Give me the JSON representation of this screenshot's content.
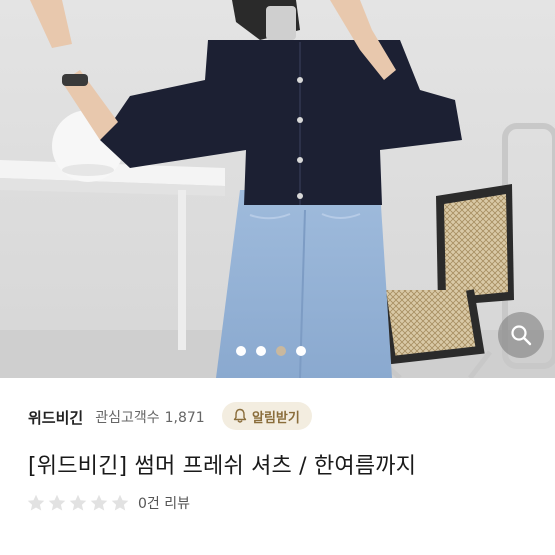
{
  "seller": {
    "name": "위드비긴",
    "followers_label": "관심고객수",
    "followers_count": "1,871",
    "alert_button_label": "알림받기"
  },
  "product": {
    "title": "[위드비긴] 썸머 프레쉬 셔츠 / 한여름까지",
    "rating": 0,
    "max_rating": 5,
    "review_label": "0건 리뷰"
  },
  "gallery": {
    "image_count": 4,
    "active_index": 2
  },
  "icons": {
    "zoom": "search-icon",
    "alert": "bell-icon",
    "rating": "star-icon"
  },
  "colors": {
    "accent": "#8a6d3b",
    "alert_bg": "#f3ede0",
    "star_empty": "#e2e2e2",
    "active_dot": "#c9b89e"
  }
}
